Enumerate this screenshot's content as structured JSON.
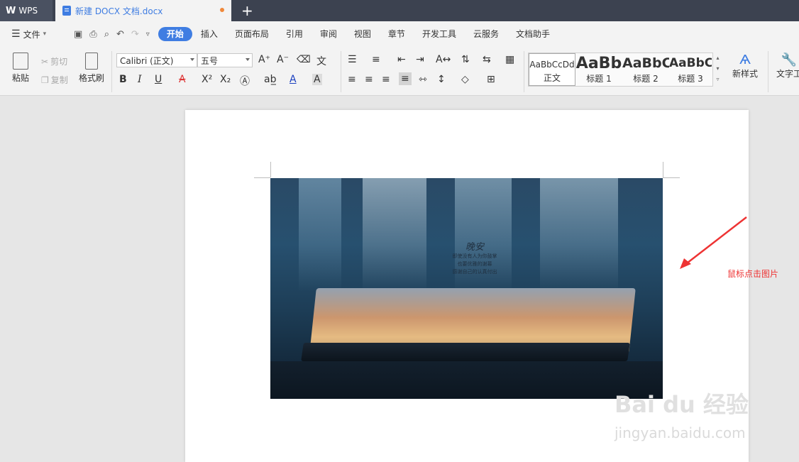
{
  "tabs": {
    "app": "WPS",
    "doc": "新建 DOCX 文档.docx",
    "add": "+"
  },
  "menu": {
    "file": "文件",
    "tabs": [
      "开始",
      "插入",
      "页面布局",
      "引用",
      "审阅",
      "视图",
      "章节",
      "开发工具",
      "云服务",
      "文档助手"
    ]
  },
  "ribbon": {
    "paste": "粘贴",
    "cut": "剪切",
    "copy": "复制",
    "format_painter": "格式刷",
    "font_name": "Calibri (正文)",
    "font_size": "五号",
    "bold": "B",
    "italic": "I",
    "underline": "U",
    "strike": "A",
    "superscript": "X²",
    "subscript": "X₂",
    "new_style": "新样式",
    "text_tools": "文字工"
  },
  "styles": [
    {
      "preview": "AaBbCcDd",
      "name": "正文"
    },
    {
      "preview": "AaBb",
      "name": "标题 1"
    },
    {
      "preview": "AaBbC",
      "name": "标题 2"
    },
    {
      "preview": "AaBbC",
      "name": "标题 3"
    }
  ],
  "photo": {
    "title": "晚安",
    "lines": [
      "即使没有人为你鼓掌",
      "也要优雅的谢幕",
      "感谢自己的认真付出"
    ]
  },
  "annotation": "鼠标点击图片",
  "watermark": {
    "main": "Bai du 经验",
    "sub": "jingyan.baidu.com"
  },
  "colors": {
    "accent": "#3f7de2",
    "annotation": "#e33333",
    "tab_modified_dot": "#f0883a"
  }
}
